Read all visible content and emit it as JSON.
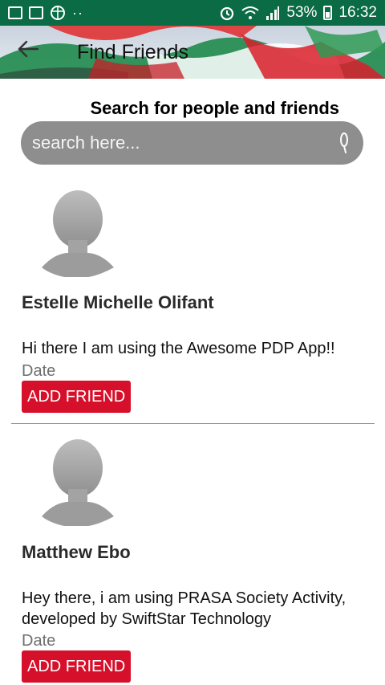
{
  "status_bar": {
    "battery": "53%",
    "time": "16:32",
    "dots": "··",
    "icons": [
      "mail-icon",
      "gallery-icon",
      "globe-icon",
      "alarm-icon",
      "wifi-icon",
      "signal-icon",
      "battery-icon"
    ]
  },
  "app_bar": {
    "title": "Find Friends",
    "back_icon": "arrow-left-icon"
  },
  "search": {
    "title": "Search for people and friends",
    "placeholder": "search here...",
    "icon": "search-icon"
  },
  "users": [
    {
      "name": "Estelle Michelle Olifant",
      "status": "Hi there I am using the Awesome PDP App!!",
      "date_label": "Date",
      "button_label": "ADD FRIEND"
    },
    {
      "name": "Matthew Ebo",
      "status": "Hey there, i am using PRASA Society Activity, developed by SwiftStar Technology",
      "date_label": "Date",
      "button_label": "ADD FRIEND"
    }
  ],
  "colors": {
    "status_bar": "#0a6b45",
    "search_bar": "#8e8e8e",
    "add_button": "#d60f2a"
  }
}
